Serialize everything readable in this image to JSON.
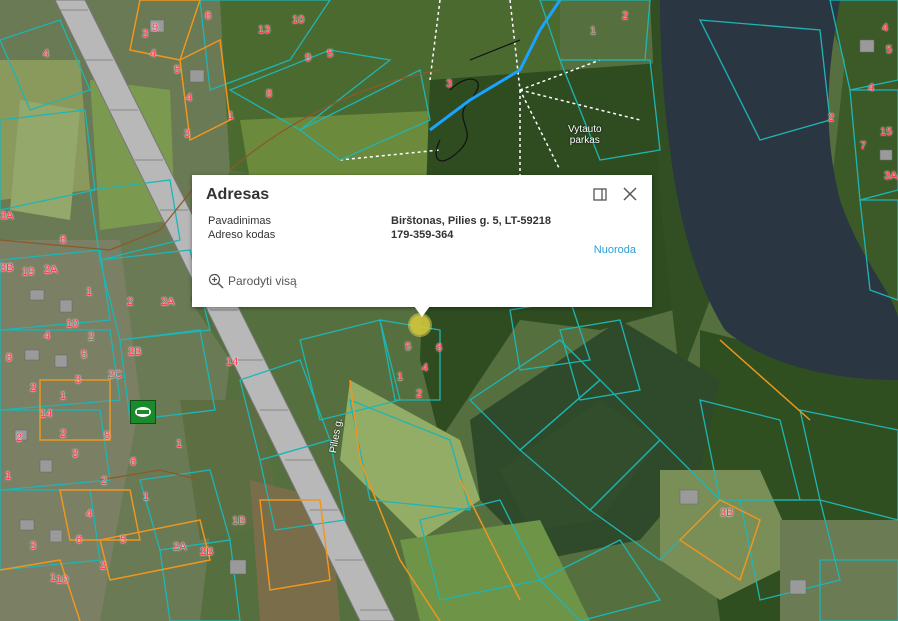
{
  "popup": {
    "title": "Adresas",
    "rows": [
      {
        "label": "Pavadinimas",
        "value": "Birštonas, Pilies g. 5, LT-59218"
      },
      {
        "label": "Adreso kodas",
        "value": "179-359-364"
      }
    ],
    "link_label": "Nuoroda",
    "zoom_label": "Parodyti visą",
    "icons": {
      "maximize": "maximize-icon",
      "close": "close-icon",
      "zoom": "zoom-in-icon"
    }
  },
  "map": {
    "street_labels": [
      "Pilies g."
    ],
    "park_label": [
      "Vytauto",
      "parkas"
    ],
    "parcel_numbers": [
      "4",
      "10",
      "5",
      "9",
      "8",
      "6",
      "13",
      "19",
      "3A",
      "6",
      "2",
      "2A",
      "2B",
      "2C",
      "14",
      "1",
      "2",
      "4",
      "3",
      "5",
      "1",
      "2",
      "3",
      "2",
      "4",
      "1",
      "6",
      "5",
      "3",
      "1",
      "2",
      "2A",
      "2B",
      "1B",
      "10",
      "9",
      "5",
      "4",
      "1",
      "3",
      "6",
      "5",
      "1",
      "2",
      "4",
      "3",
      "1",
      "2",
      "3",
      "4",
      "5",
      "6",
      "1",
      "2",
      "14",
      "8",
      "10",
      "2",
      "4",
      "5",
      "4",
      "15",
      "3A",
      "2",
      "7",
      "2A",
      "3B",
      "3B",
      "1"
    ],
    "colors": {
      "parcel_outline": "#1fb5b5",
      "cadastre_outline": "#f0961e",
      "parcel_label": "#ff2f4a",
      "river": "#2a3642",
      "railway": "#b8b8b8",
      "forest": "#2f4f22",
      "field": "#6f8e4f"
    }
  }
}
